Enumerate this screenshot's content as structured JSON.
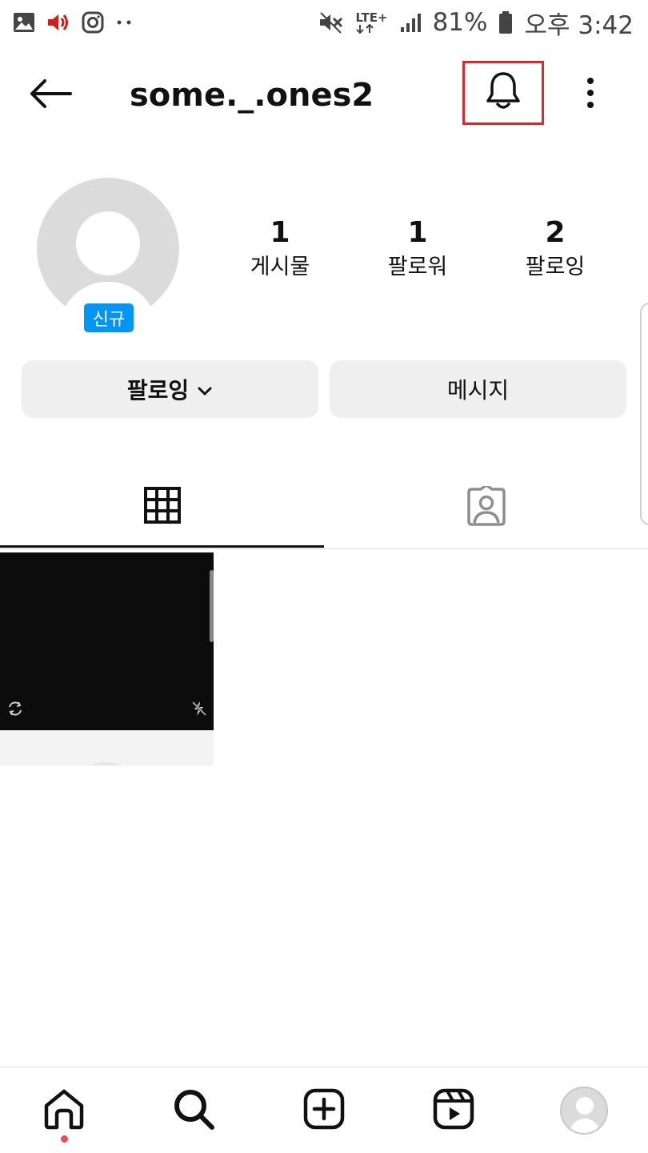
{
  "status_bar": {
    "left_icons": [
      "gallery-icon",
      "volume-icon",
      "instagram-icon",
      "more-dots-icon"
    ],
    "right_icons": [
      "mute-icon",
      "lte-icon",
      "signal-icon",
      "battery-icon"
    ],
    "network": "LTE+",
    "battery": "81%",
    "time": "오후 3:42",
    "colors": {
      "volume": "#cc1f1f",
      "icon": "#444444"
    }
  },
  "header": {
    "username": "some._.ones2",
    "icons": [
      "back-arrow-icon",
      "bell-icon",
      "more-vertical-icon"
    ],
    "highlight_color": "#e0252b"
  },
  "profile": {
    "avatar_icon": "default-avatar-icon",
    "badge": "신규",
    "badge_color": "#0095f6",
    "stats": [
      {
        "value": "1",
        "label": "게시물"
      },
      {
        "value": "1",
        "label": "팔로워"
      },
      {
        "value": "2",
        "label": "팔로잉"
      }
    ]
  },
  "actions": {
    "following_label": "팔로잉",
    "following_icon": "chevron-down-icon",
    "message_label": "메시지"
  },
  "tabs": [
    {
      "name": "grid",
      "icon": "grid-icon",
      "active": true
    },
    {
      "name": "tagged",
      "icon": "tagged-person-icon",
      "active": false
    }
  ],
  "posts": [
    {
      "icons": [
        "rotate-camera-icon",
        "flash-off-icon"
      ]
    }
  ],
  "bottom_nav": {
    "items": [
      "home-icon",
      "search-icon",
      "create-icon",
      "reels-icon",
      "profile-avatar-icon"
    ],
    "notification_dot_color": "#ed4956"
  }
}
